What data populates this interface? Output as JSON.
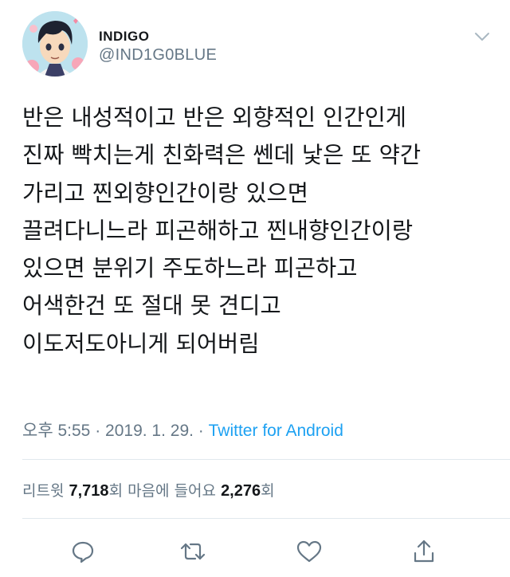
{
  "user": {
    "name": "INDIGO",
    "handle": "@IND1G0BLUE"
  },
  "tweet": {
    "lines": [
      "반은 내성적이고 반은 외향적인 인간인게",
      "진짜 빡치는게 친화력은 쎈데 낯은 또 약간",
      "가리고 찐외향인간이랑 있으면",
      "끌려다니느라 피곤해하고 찐내향인간이랑",
      "있으면 분위기 주도하느라 피곤하고",
      "어색한건 또 절대 못 견디고",
      "이도저도아니게 되어버림"
    ]
  },
  "meta": {
    "time": "오후 5:55",
    "separator": " · ",
    "date": "2019. 1. 29.",
    "source": "Twitter for Android"
  },
  "stats": {
    "retweets_label": "리트윗",
    "retweets_count": "7,718",
    "retweets_unit": "회",
    "likes_label": "마음에 들어요",
    "likes_count": "2,276",
    "likes_unit": "회"
  },
  "icons": {
    "reply": "reply-icon",
    "retweet": "retweet-icon",
    "like": "heart-icon",
    "share": "share-icon",
    "caret": "chevron-down-icon"
  },
  "colors": {
    "text": "#14171a",
    "secondary": "#657786",
    "link": "#1da1f2",
    "divider": "#e1e8ed"
  }
}
